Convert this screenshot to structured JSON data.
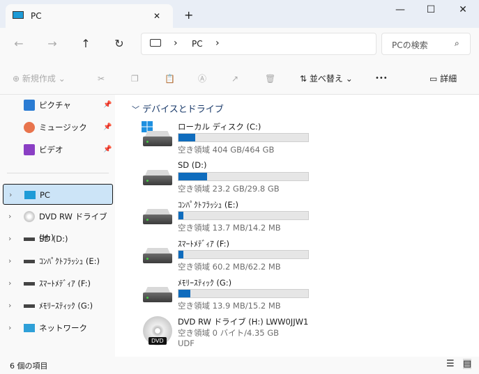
{
  "window": {
    "tab_title": "PC",
    "new_tab": "+",
    "minimize": "—",
    "maximize": "☐",
    "close": "✕",
    "tab_close": "✕"
  },
  "nav": {
    "back": "←",
    "forward": "→",
    "up": "↑",
    "refresh": "↻"
  },
  "address": {
    "breadcrumb": [
      "PC"
    ],
    "sep": "›"
  },
  "search": {
    "placeholder": "PCの検索"
  },
  "toolbar": {
    "new": "新規作成",
    "sort": "並べ替え",
    "more": "•••",
    "details": "詳細"
  },
  "sidebar": {
    "pinned": [
      {
        "label": "ピクチャ"
      },
      {
        "label": "ミュージック"
      },
      {
        "label": "ビデオ"
      }
    ],
    "tree": [
      {
        "label": "PC",
        "selected": true
      },
      {
        "label": "DVD RW ドライブ (H:)"
      },
      {
        "label": "SD (D:)"
      },
      {
        "label": "ｺﾝﾊﾟｸﾄﾌﾗｯｼｭ (E:)"
      },
      {
        "label": "ｽﾏｰﾄﾒﾃﾞｨｱ (F:)"
      },
      {
        "label": "ﾒﾓﾘｰｽﾃｨｯｸ (G:)"
      },
      {
        "label": "ネットワーク"
      }
    ]
  },
  "content": {
    "group_title": "デバイスとドライブ",
    "drives": [
      {
        "name": "ローカル ディスク (C:)",
        "free": "空き領域 404 GB/464 GB",
        "used_fraction": 0.13
      },
      {
        "name": "SD (D:)",
        "free": "空き領域 23.2 GB/29.8 GB",
        "used_fraction": 0.22
      },
      {
        "name": "ｺﾝﾊﾟｸﾄﾌﾗｯｼｭ (E:)",
        "free": "空き領域 13.7 MB/14.2 MB",
        "used_fraction": 0.04
      },
      {
        "name": "ｽﾏｰﾄﾒﾃﾞｨｱ (F:)",
        "free": "空き領域 60.2 MB/62.2 MB",
        "used_fraction": 0.04
      },
      {
        "name": "ﾒﾓﾘｰｽﾃｨｯｸ (G:)",
        "free": "空き領域 13.9 MB/15.2 MB",
        "used_fraction": 0.09
      }
    ],
    "dvd": {
      "name": "DVD RW ドライブ (H:) LWW0JJW1",
      "free": "空き領域 0 バイト/4.35 GB",
      "fs": "UDF",
      "badge": "DVD"
    }
  },
  "status": {
    "count": "6 個の項目"
  },
  "colors": {
    "accent": "#0f6cbd",
    "selection": "#cce4f7"
  }
}
